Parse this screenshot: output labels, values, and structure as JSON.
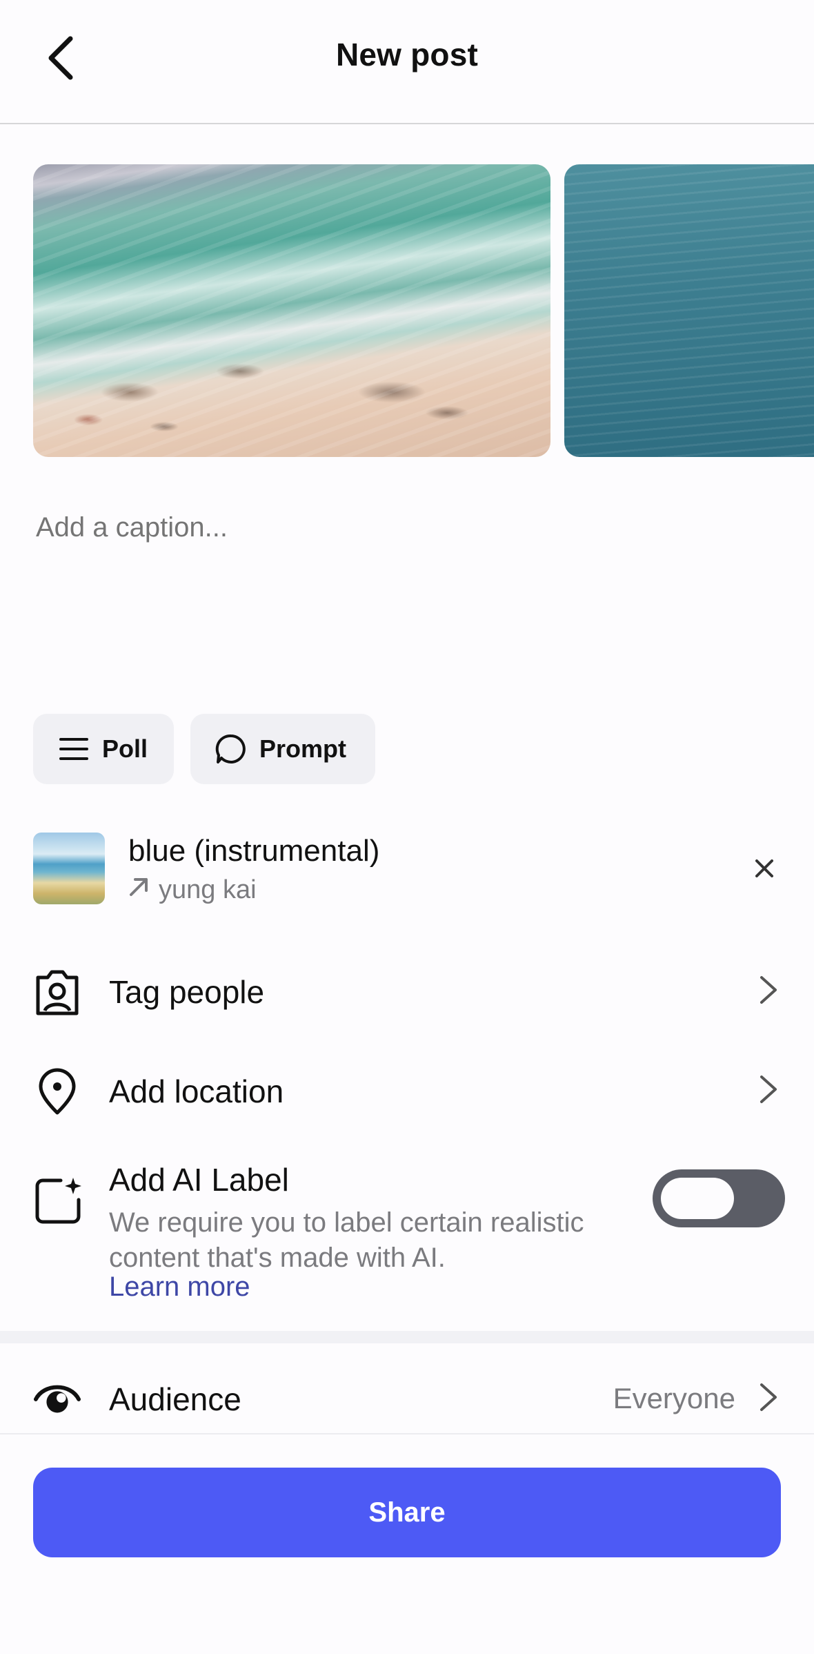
{
  "header": {
    "title": "New post",
    "back_icon": "chevron-left-icon"
  },
  "media": [
    {
      "name": "beach-aerial-photo"
    },
    {
      "name": "ocean-water-photo"
    }
  ],
  "caption": {
    "placeholder": "Add a caption...",
    "value": ""
  },
  "chips": {
    "poll": {
      "label": "Poll",
      "icon": "list-icon"
    },
    "prompt": {
      "label": "Prompt",
      "icon": "speech-bubble-icon"
    }
  },
  "music": {
    "title": "blue (instrumental)",
    "artist": "yung kai",
    "artist_icon": "arrow-up-right-icon",
    "close_icon": "close-icon"
  },
  "rows": {
    "tag_people": {
      "label": "Tag people",
      "icon": "person-tag-icon"
    },
    "add_location": {
      "label": "Add location",
      "icon": "location-pin-icon"
    },
    "audience": {
      "label": "Audience",
      "value": "Everyone",
      "icon": "eye-icon"
    }
  },
  "ai_label": {
    "title": "Add AI Label",
    "description": "We require you to label certain realistic content that's made with AI.",
    "link": "Learn more",
    "enabled": false,
    "icon": "ai-sparkle-icon"
  },
  "share": {
    "label": "Share"
  },
  "colors": {
    "accent": "#4d5af5",
    "link": "#3e47a6",
    "toggle_off": "#5b5d66",
    "secondary_text": "#7b7b7f"
  }
}
